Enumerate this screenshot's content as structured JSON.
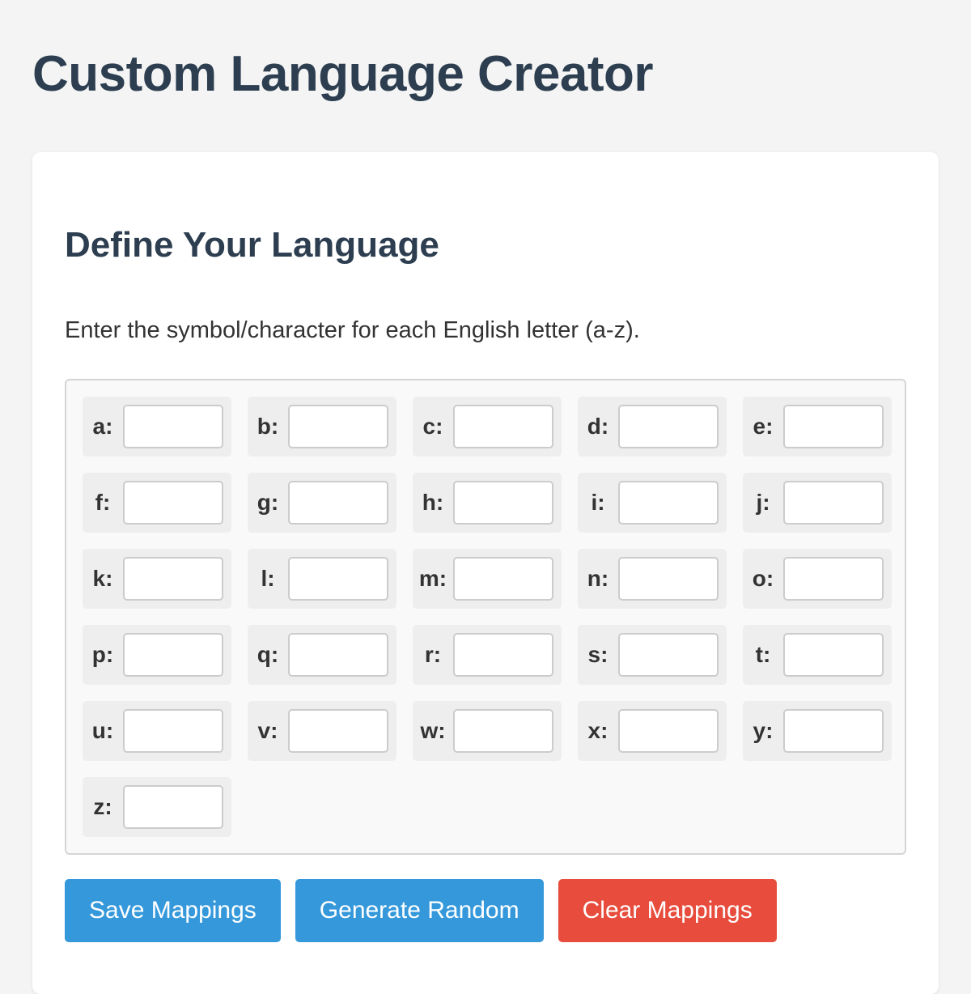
{
  "header": {
    "title": "Custom Language Creator"
  },
  "define_section": {
    "title": "Define Your Language",
    "instructions": "Enter the symbol/character for each English letter (a-z).",
    "mappings": [
      {
        "label": "a:",
        "value": ""
      },
      {
        "label": "b:",
        "value": ""
      },
      {
        "label": "c:",
        "value": ""
      },
      {
        "label": "d:",
        "value": ""
      },
      {
        "label": "e:",
        "value": ""
      },
      {
        "label": "f:",
        "value": ""
      },
      {
        "label": "g:",
        "value": ""
      },
      {
        "label": "h:",
        "value": ""
      },
      {
        "label": "i:",
        "value": ""
      },
      {
        "label": "j:",
        "value": ""
      },
      {
        "label": "k:",
        "value": ""
      },
      {
        "label": "l:",
        "value": ""
      },
      {
        "label": "m:",
        "value": ""
      },
      {
        "label": "n:",
        "value": ""
      },
      {
        "label": "o:",
        "value": ""
      },
      {
        "label": "p:",
        "value": ""
      },
      {
        "label": "q:",
        "value": ""
      },
      {
        "label": "r:",
        "value": ""
      },
      {
        "label": "s:",
        "value": ""
      },
      {
        "label": "t:",
        "value": ""
      },
      {
        "label": "u:",
        "value": ""
      },
      {
        "label": "v:",
        "value": ""
      },
      {
        "label": "w:",
        "value": ""
      },
      {
        "label": "x:",
        "value": ""
      },
      {
        "label": "y:",
        "value": ""
      },
      {
        "label": "z:",
        "value": ""
      }
    ],
    "buttons": {
      "save_label": "Save Mappings",
      "random_label": "Generate Random",
      "clear_label": "Clear Mappings"
    }
  },
  "colors": {
    "heading": "#2c3e50",
    "primary_button": "#3498db",
    "danger_button": "#e74c3c"
  }
}
